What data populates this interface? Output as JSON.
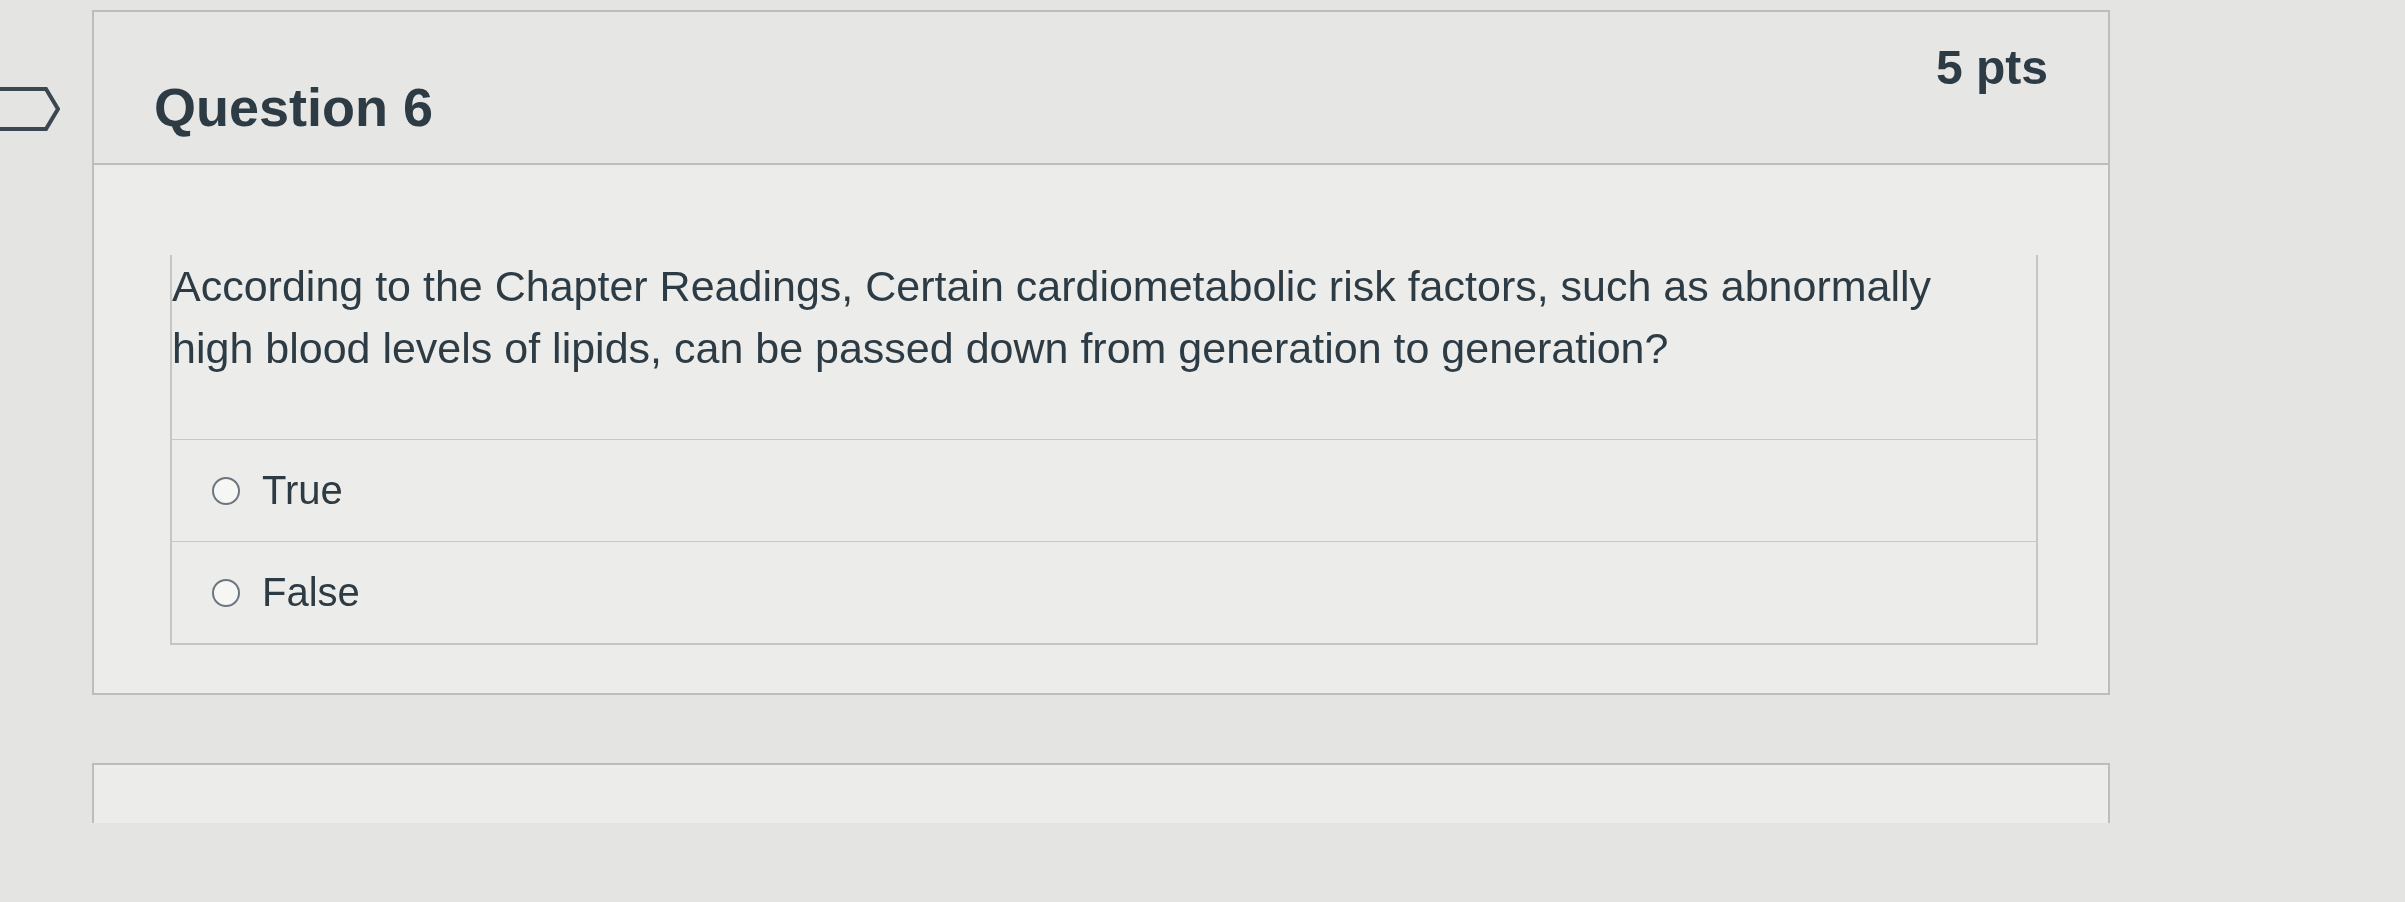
{
  "question": {
    "title": "Question 6",
    "points": "5 pts",
    "text": "According to the Chapter Readings, Certain cardiometabolic risk factors, such as abnormally high blood levels of lipids, can be passed down from generation to generation?",
    "answers": [
      {
        "label": "True",
        "selected": false
      },
      {
        "label": "False",
        "selected": false
      }
    ]
  }
}
